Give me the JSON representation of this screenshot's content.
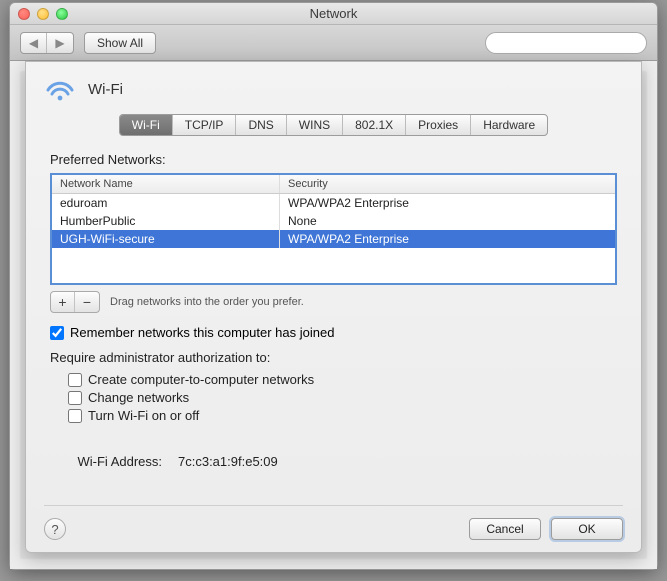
{
  "window": {
    "title": "Network"
  },
  "toolbar": {
    "show_all": "Show All",
    "search_placeholder": ""
  },
  "sheet": {
    "title": "Wi-Fi",
    "tabs": [
      {
        "label": "Wi-Fi",
        "active": true
      },
      {
        "label": "TCP/IP"
      },
      {
        "label": "DNS"
      },
      {
        "label": "WINS"
      },
      {
        "label": "802.1X"
      },
      {
        "label": "Proxies"
      },
      {
        "label": "Hardware"
      }
    ],
    "preferred_label": "Preferred Networks:",
    "columns": {
      "name": "Network Name",
      "security": "Security"
    },
    "networks": [
      {
        "name": "eduroam",
        "security": "WPA/WPA2 Enterprise",
        "selected": false
      },
      {
        "name": "HumberPublic",
        "security": "None",
        "selected": false
      },
      {
        "name": "UGH-WiFi-secure",
        "security": "WPA/WPA2 Enterprise",
        "selected": true
      }
    ],
    "drag_hint": "Drag networks into the order you prefer.",
    "remember_label": "Remember networks this computer has joined",
    "remember_checked": true,
    "admin_label": "Require administrator authorization to:",
    "admin_options": [
      {
        "label": "Create computer-to-computer networks",
        "checked": false
      },
      {
        "label": "Change networks",
        "checked": false
      },
      {
        "label": "Turn Wi-Fi on or off",
        "checked": false
      }
    ],
    "mac_label": "Wi-Fi Address:",
    "mac_value": "7c:c3:a1:9f:e5:09",
    "help": "?",
    "cancel": "Cancel",
    "ok": "OK"
  }
}
